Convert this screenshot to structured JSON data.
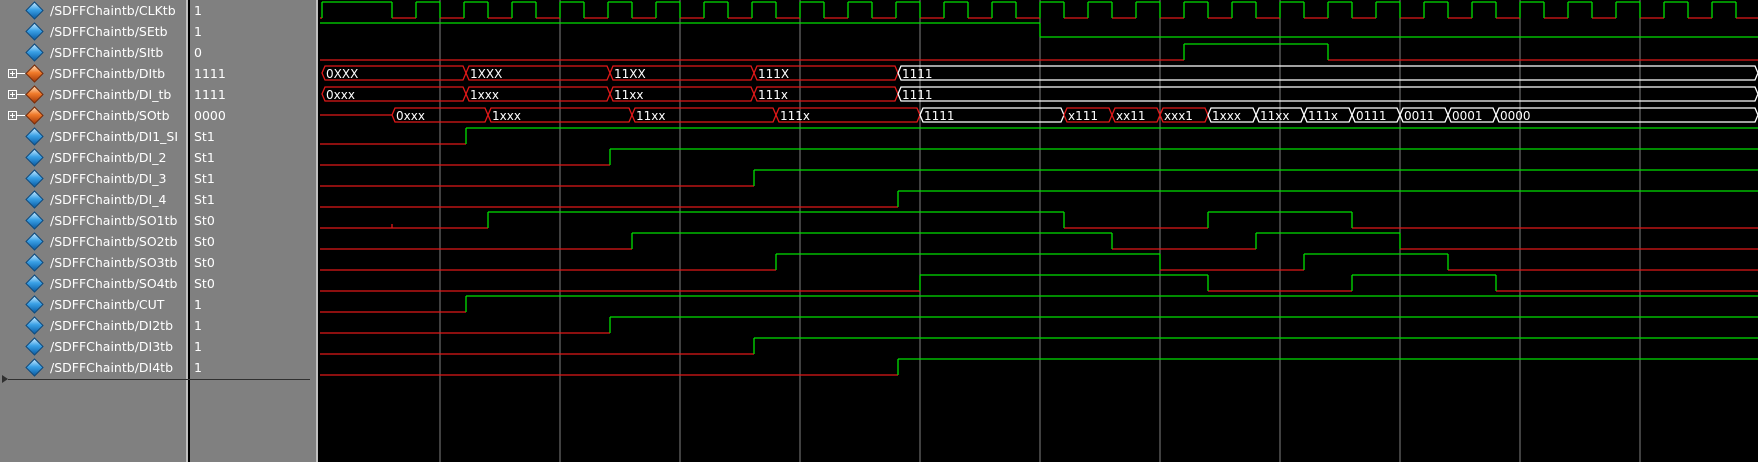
{
  "signals": [
    {
      "name": "/SDFFChaintb/CLKtb",
      "value": "1",
      "icon": "blue-diamond-icon",
      "expandable": false
    },
    {
      "name": "/SDFFChaintb/SEtb",
      "value": "1",
      "icon": "blue-diamond-icon",
      "expandable": false
    },
    {
      "name": "/SDFFChaintb/SItb",
      "value": "0",
      "icon": "blue-diamond-icon",
      "expandable": false
    },
    {
      "name": "/SDFFChaintb/DItb",
      "value": "1111",
      "icon": "orange-diamond-icon",
      "expandable": true
    },
    {
      "name": "/SDFFChaintb/DI_tb",
      "value": "1111",
      "icon": "orange-diamond-icon",
      "expandable": true
    },
    {
      "name": "/SDFFChaintb/SOtb",
      "value": "0000",
      "icon": "orange-diamond-icon",
      "expandable": true
    },
    {
      "name": "/SDFFChaintb/DI1_SI",
      "value": "St1",
      "icon": "blue-diamond-icon",
      "expandable": false
    },
    {
      "name": "/SDFFChaintb/DI_2",
      "value": "St1",
      "icon": "blue-diamond-icon",
      "expandable": false
    },
    {
      "name": "/SDFFChaintb/DI_3",
      "value": "St1",
      "icon": "blue-diamond-icon",
      "expandable": false
    },
    {
      "name": "/SDFFChaintb/DI_4",
      "value": "St1",
      "icon": "blue-diamond-icon",
      "expandable": false
    },
    {
      "name": "/SDFFChaintb/SO1tb",
      "value": "St0",
      "icon": "blue-diamond-icon",
      "expandable": false
    },
    {
      "name": "/SDFFChaintb/SO2tb",
      "value": "St0",
      "icon": "blue-diamond-icon",
      "expandable": false
    },
    {
      "name": "/SDFFChaintb/SO3tb",
      "value": "St0",
      "icon": "blue-diamond-icon",
      "expandable": false
    },
    {
      "name": "/SDFFChaintb/SO4tb",
      "value": "St0",
      "icon": "blue-diamond-icon",
      "expandable": false
    },
    {
      "name": "/SDFFChaintb/CUT",
      "value": "1",
      "icon": "blue-diamond-icon",
      "expandable": false
    },
    {
      "name": "/SDFFChaintb/DI2tb",
      "value": "1",
      "icon": "blue-diamond-icon",
      "expandable": false
    },
    {
      "name": "/SDFFChaintb/DI3tb",
      "value": "1",
      "icon": "blue-diamond-icon",
      "expandable": false
    },
    {
      "name": "/SDFFChaintb/DI4tb",
      "value": "1",
      "icon": "blue-diamond-icon",
      "expandable": false
    }
  ],
  "bus_labels": {
    "DItb": [
      "0XXX",
      "1XXX",
      "11XX",
      "111X",
      "1111"
    ],
    "DI_tb": [
      "0xxx",
      "1xxx",
      "11xx",
      "111x",
      "1111"
    ],
    "SOtb": [
      "0xxx",
      "1xxx",
      "11xx",
      "111x",
      "1111",
      "x111",
      "xx11",
      "xxx1",
      "1xxx",
      "11xx",
      "111x",
      "0111",
      "0011",
      "0001",
      "0000"
    ]
  },
  "colors": {
    "background": "#000000",
    "panel": "#808080",
    "high_level": "#00e000",
    "low_level": "#e01818",
    "bus_settled": "#ffffff",
    "grid": "#808080"
  }
}
